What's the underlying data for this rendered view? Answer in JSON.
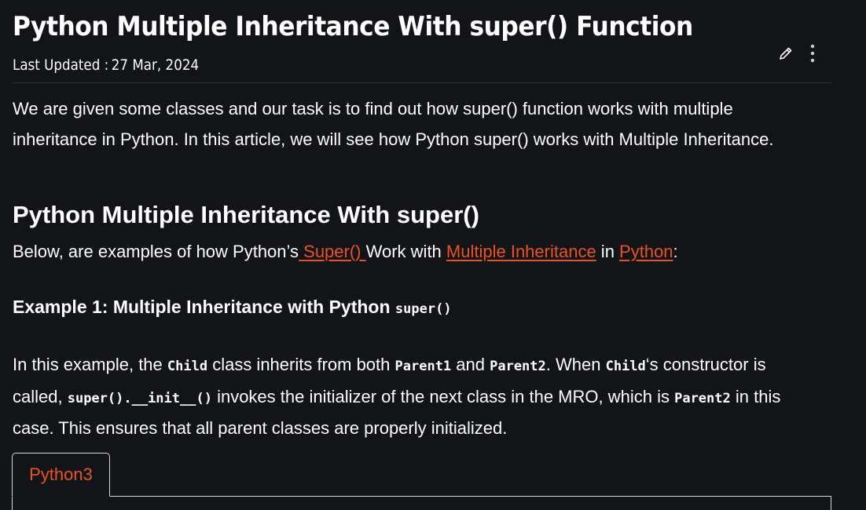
{
  "article": {
    "title": "Python Multiple Inheritance With super() Function",
    "updated_label": "Last Updated :",
    "updated_date": "27 Mar, 2024"
  },
  "toolbar": {
    "edit_icon": "pencil-icon",
    "more_icon": "vertical-dots-icon"
  },
  "intro": "We are given some classes and our task is to find out how super() function works with multiple inheritance in Python. In this article, we will see how Python super() works with Multiple Inheritance.",
  "section": {
    "heading": "Python Multiple Inheritance With super()",
    "below_prefix": "Below, are examples of how Python’s",
    "link1": " Super() ",
    "mid1": "Work with ",
    "link2": "Multiple Inheritance",
    "mid2": " in ",
    "link3": "Python",
    "suffix": ":"
  },
  "example1": {
    "heading_text": "Example 1: Multiple Inheritance with Python ",
    "heading_code": "super()",
    "p1": "In this example, the ",
    "c1": "Child",
    "p2": " class inherits from both ",
    "c2": "Parent1",
    "p3": " and ",
    "c3": "Parent2",
    "p4": ". When ",
    "c4": "Child",
    "p5": "‘s constructor is called, ",
    "c5": "super().__init__()",
    "p6": " invokes the initializer of the next class in the MRO, which is ",
    "c6": "Parent2",
    "p7": " in this case. This ensures that all parent classes are properly initialized."
  },
  "code_tabs": [
    "Python3"
  ],
  "colors": {
    "background": "#131417",
    "text": "#ffffff",
    "link": "#e8531f",
    "divider": "#2e3036"
  }
}
